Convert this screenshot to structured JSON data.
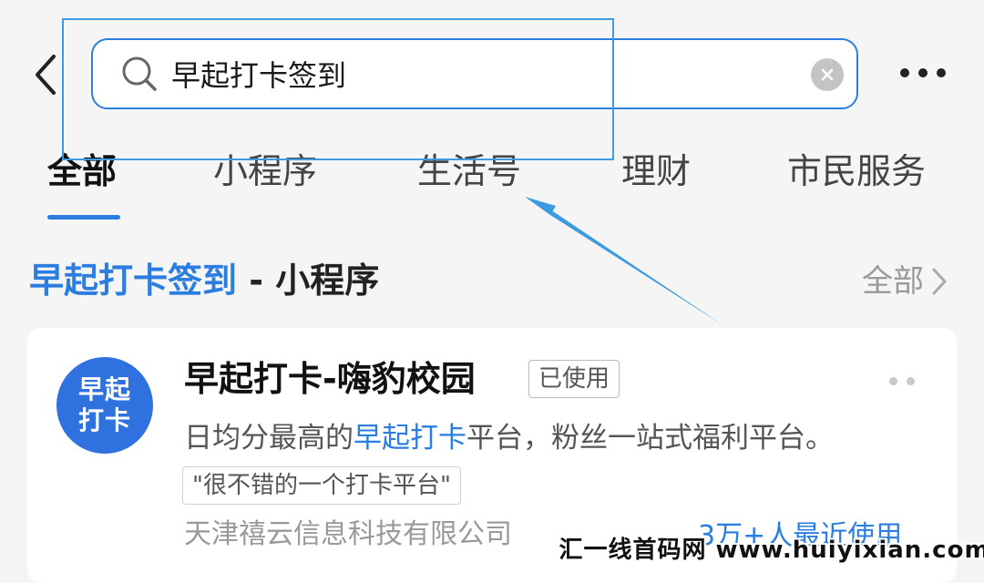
{
  "colors": {
    "accent": "#2b7de0",
    "annotation": "#3d9be0",
    "logo_bg": "#2f72df",
    "muted_text": "#999999"
  },
  "header": {
    "back_icon": "chevron-left-icon",
    "search_icon": "search-icon",
    "search_value": "早起打卡签到",
    "clear_icon": "clear-circle-icon",
    "more_icon": "more-dots-icon"
  },
  "tabs": [
    {
      "label": "全部",
      "active": true
    },
    {
      "label": "小程序",
      "active": false
    },
    {
      "label": "生活号",
      "active": false
    },
    {
      "label": "理财",
      "active": false
    },
    {
      "label": "市民服务",
      "active": false
    }
  ],
  "section": {
    "title_highlight": "早起打卡签到",
    "title_rest": " - 小程序",
    "more_label": "全部",
    "more_icon": "chevron-right-icon"
  },
  "card": {
    "logo_text": "早起打卡",
    "name": "早起打卡-嗨豹校园",
    "badge": "已使用",
    "more_icon": "more-dots-icon",
    "desc_before": "日均分最高的",
    "desc_highlight": "早起打卡",
    "desc_after": "平台，粉丝一站式福利平台。",
    "review": "\"很不错的一个打卡平台\"",
    "developer": "天津禧云信息科技有限公司",
    "usage": "3万+人最近使用"
  },
  "watermark": {
    "text": "汇一线首码网 www.huiyixian.com"
  }
}
